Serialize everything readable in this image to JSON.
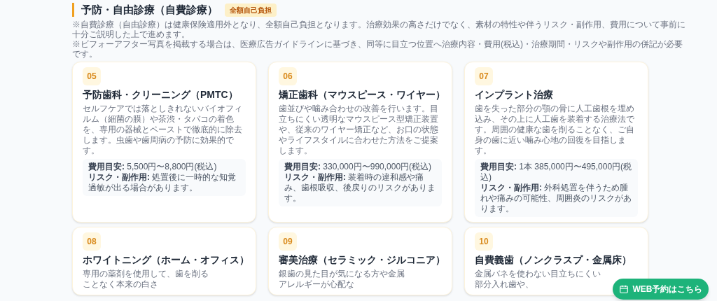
{
  "section": {
    "title": "予防・自由診療（自費診療）",
    "badge": "全額自己負担",
    "notes": [
      "※自費診療（自由診療）は健康保険適用外となり、全額自己負担となります。治療効果の高さだけでなく、素材の特性や伴うリスク・副作用、費用について事前に十分ご説明した上で進めます。",
      "※ビフォーアフター写真を掲載する場合は、医療広告ガイドラインに基づき、同等に目立つ位置へ治療内容・費用(税込)・治療期間・リスクや副作用の併記が必要です。"
    ],
    "cards": [
      {
        "number": "05",
        "title": "予防歯科・クリーニング（PMTC）",
        "description": "セルフケアでは落としきれないバイオフィルム（細菌の膜）や茶渋・タバコの着色を、専用の器械とペーストで徹底的に除去します。虫歯や歯周病の予防に効果的です。",
        "cost_label": "費用目安:",
        "cost": "5,500円〜8,800円(税込)",
        "risk_label": "リスク・副作用:",
        "risk": "処置後に一時的な知覚過敏が出る場合があります。"
      },
      {
        "number": "06",
        "title": "矯正歯科（マウスピース・ワイヤー）",
        "description": "歯並びや噛み合わせの改善を行います。目立ちにくい透明なマウスピース型矯正装置や、従来のワイヤー矯正など、お口の状態やライフスタイルに合わせた方法をご提案します。",
        "cost_label": "費用目安:",
        "cost": "330,000円〜990,000円(税込)",
        "risk_label": "リスク・副作用:",
        "risk": "装着時の違和感や痛み、歯根吸収、後戻りのリスクがあります。"
      },
      {
        "number": "07",
        "title": "インプラント治療",
        "description": "歯を失った部分の顎の骨に人工歯根を埋め込み、その上に人工歯を装着する治療法です。周囲の健康な歯を削ることなく、ご自身の歯に近い噛み心地の回復を目指します。",
        "cost_label": "費用目安:",
        "cost": "1本 385,000円〜495,000円(税込)",
        "risk_label": "リスク・副作用:",
        "risk": "外科処置を伴うため腫れや痛みの可能性、周囲炎のリスクがあります。"
      },
      {
        "number": "08",
        "title": "ホワイトニング（ホーム・オフィス）",
        "description": "専用の薬剤を使用して、歯を削ることなく本来の白さ"
      },
      {
        "number": "09",
        "title": "審美治療（セラミック・ジルコニア）",
        "description": "銀歯の見た目が気になる方や金属アレルギーが心配な"
      },
      {
        "number": "10",
        "title": "自費義歯（ノンクラスプ・金属床）",
        "description": "金属バネを使わない目立ちにくい部分入れ歯や、"
      }
    ]
  },
  "cta_button": {
    "label": "WEB予約はこちら"
  }
}
